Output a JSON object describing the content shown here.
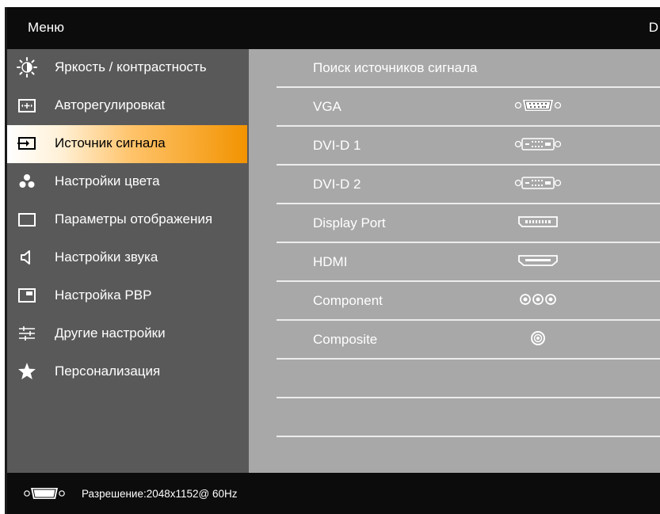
{
  "header": {
    "title": "Меню",
    "brand": "D"
  },
  "sidebar": {
    "items": [
      {
        "label": "Яркость / контрастность",
        "icon": "brightness-icon"
      },
      {
        "label": "Авторегулировкat",
        "icon": "auto-adjust-icon"
      },
      {
        "label": "Источник сигнала",
        "icon": "input-source-icon",
        "active": true
      },
      {
        "label": "Настройки цвета",
        "icon": "color-dots-icon"
      },
      {
        "label": "Параметры отображения",
        "icon": "display-rect-icon"
      },
      {
        "label": "Настройки звука",
        "icon": "speaker-icon"
      },
      {
        "label": "Настройка PBP",
        "icon": "pbp-icon"
      },
      {
        "label": "Другие настройки",
        "icon": "sliders-icon"
      },
      {
        "label": "Персонализация",
        "icon": "star-icon"
      }
    ]
  },
  "main": {
    "title": "Поиск источников сигнала",
    "sources": [
      {
        "label": "VGA",
        "icon": "vga-port-icon"
      },
      {
        "label": "DVI-D 1",
        "icon": "dvi-port-icon"
      },
      {
        "label": "DVI-D 2",
        "icon": "dvi-port-icon"
      },
      {
        "label": "Display Port",
        "icon": "displayport-icon"
      },
      {
        "label": "HDMI",
        "icon": "hdmi-port-icon"
      },
      {
        "label": "Component",
        "icon": "component-port-icon"
      },
      {
        "label": "Composite",
        "icon": "composite-port-icon"
      }
    ]
  },
  "footer": {
    "resolution": "Разрешение:2048x1152@ 60Hz",
    "icon": "vga-port-icon"
  },
  "colors": {
    "header_bg": "#0c0c0c",
    "sidebar_bg": "#595959",
    "main_bg": "#a8a8a8",
    "active_highlight": "#f29300",
    "row_divider": "#ececec"
  }
}
